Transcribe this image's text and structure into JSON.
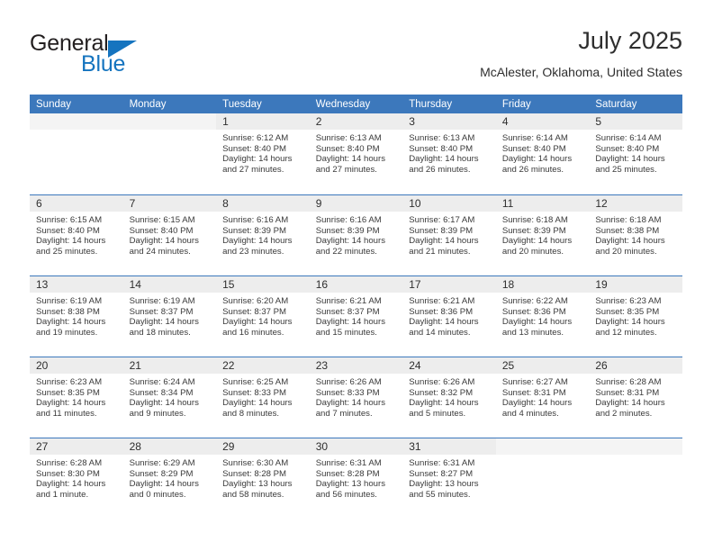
{
  "brand": {
    "name_top": "General",
    "name_bottom": "Blue",
    "color_dark": "#231f20",
    "color_blue": "#1574bf"
  },
  "header": {
    "title": "July 2025",
    "subtitle": "McAlester, Oklahoma, United States"
  },
  "theme": {
    "header_bg": "#3c78bc",
    "daynum_bg": "#ededed",
    "separator": "#3c78bc"
  },
  "weekdays": [
    "Sunday",
    "Monday",
    "Tuesday",
    "Wednesday",
    "Thursday",
    "Friday",
    "Saturday"
  ],
  "labels": {
    "sunrise": "Sunrise:",
    "sunset": "Sunset:",
    "daylight": "Daylight:"
  },
  "weeks": [
    [
      {
        "day": "",
        "sunrise": "",
        "sunset": "",
        "daylight_1": "",
        "daylight_2": ""
      },
      {
        "day": "",
        "sunrise": "",
        "sunset": "",
        "daylight_1": "",
        "daylight_2": ""
      },
      {
        "day": "1",
        "sunrise": "Sunrise: 6:12 AM",
        "sunset": "Sunset: 8:40 PM",
        "daylight_1": "Daylight: 14 hours",
        "daylight_2": "and 27 minutes."
      },
      {
        "day": "2",
        "sunrise": "Sunrise: 6:13 AM",
        "sunset": "Sunset: 8:40 PM",
        "daylight_1": "Daylight: 14 hours",
        "daylight_2": "and 27 minutes."
      },
      {
        "day": "3",
        "sunrise": "Sunrise: 6:13 AM",
        "sunset": "Sunset: 8:40 PM",
        "daylight_1": "Daylight: 14 hours",
        "daylight_2": "and 26 minutes."
      },
      {
        "day": "4",
        "sunrise": "Sunrise: 6:14 AM",
        "sunset": "Sunset: 8:40 PM",
        "daylight_1": "Daylight: 14 hours",
        "daylight_2": "and 26 minutes."
      },
      {
        "day": "5",
        "sunrise": "Sunrise: 6:14 AM",
        "sunset": "Sunset: 8:40 PM",
        "daylight_1": "Daylight: 14 hours",
        "daylight_2": "and 25 minutes."
      }
    ],
    [
      {
        "day": "6",
        "sunrise": "Sunrise: 6:15 AM",
        "sunset": "Sunset: 8:40 PM",
        "daylight_1": "Daylight: 14 hours",
        "daylight_2": "and 25 minutes."
      },
      {
        "day": "7",
        "sunrise": "Sunrise: 6:15 AM",
        "sunset": "Sunset: 8:40 PM",
        "daylight_1": "Daylight: 14 hours",
        "daylight_2": "and 24 minutes."
      },
      {
        "day": "8",
        "sunrise": "Sunrise: 6:16 AM",
        "sunset": "Sunset: 8:39 PM",
        "daylight_1": "Daylight: 14 hours",
        "daylight_2": "and 23 minutes."
      },
      {
        "day": "9",
        "sunrise": "Sunrise: 6:16 AM",
        "sunset": "Sunset: 8:39 PM",
        "daylight_1": "Daylight: 14 hours",
        "daylight_2": "and 22 minutes."
      },
      {
        "day": "10",
        "sunrise": "Sunrise: 6:17 AM",
        "sunset": "Sunset: 8:39 PM",
        "daylight_1": "Daylight: 14 hours",
        "daylight_2": "and 21 minutes."
      },
      {
        "day": "11",
        "sunrise": "Sunrise: 6:18 AM",
        "sunset": "Sunset: 8:39 PM",
        "daylight_1": "Daylight: 14 hours",
        "daylight_2": "and 20 minutes."
      },
      {
        "day": "12",
        "sunrise": "Sunrise: 6:18 AM",
        "sunset": "Sunset: 8:38 PM",
        "daylight_1": "Daylight: 14 hours",
        "daylight_2": "and 20 minutes."
      }
    ],
    [
      {
        "day": "13",
        "sunrise": "Sunrise: 6:19 AM",
        "sunset": "Sunset: 8:38 PM",
        "daylight_1": "Daylight: 14 hours",
        "daylight_2": "and 19 minutes."
      },
      {
        "day": "14",
        "sunrise": "Sunrise: 6:19 AM",
        "sunset": "Sunset: 8:37 PM",
        "daylight_1": "Daylight: 14 hours",
        "daylight_2": "and 18 minutes."
      },
      {
        "day": "15",
        "sunrise": "Sunrise: 6:20 AM",
        "sunset": "Sunset: 8:37 PM",
        "daylight_1": "Daylight: 14 hours",
        "daylight_2": "and 16 minutes."
      },
      {
        "day": "16",
        "sunrise": "Sunrise: 6:21 AM",
        "sunset": "Sunset: 8:37 PM",
        "daylight_1": "Daylight: 14 hours",
        "daylight_2": "and 15 minutes."
      },
      {
        "day": "17",
        "sunrise": "Sunrise: 6:21 AM",
        "sunset": "Sunset: 8:36 PM",
        "daylight_1": "Daylight: 14 hours",
        "daylight_2": "and 14 minutes."
      },
      {
        "day": "18",
        "sunrise": "Sunrise: 6:22 AM",
        "sunset": "Sunset: 8:36 PM",
        "daylight_1": "Daylight: 14 hours",
        "daylight_2": "and 13 minutes."
      },
      {
        "day": "19",
        "sunrise": "Sunrise: 6:23 AM",
        "sunset": "Sunset: 8:35 PM",
        "daylight_1": "Daylight: 14 hours",
        "daylight_2": "and 12 minutes."
      }
    ],
    [
      {
        "day": "20",
        "sunrise": "Sunrise: 6:23 AM",
        "sunset": "Sunset: 8:35 PM",
        "daylight_1": "Daylight: 14 hours",
        "daylight_2": "and 11 minutes."
      },
      {
        "day": "21",
        "sunrise": "Sunrise: 6:24 AM",
        "sunset": "Sunset: 8:34 PM",
        "daylight_1": "Daylight: 14 hours",
        "daylight_2": "and 9 minutes."
      },
      {
        "day": "22",
        "sunrise": "Sunrise: 6:25 AM",
        "sunset": "Sunset: 8:33 PM",
        "daylight_1": "Daylight: 14 hours",
        "daylight_2": "and 8 minutes."
      },
      {
        "day": "23",
        "sunrise": "Sunrise: 6:26 AM",
        "sunset": "Sunset: 8:33 PM",
        "daylight_1": "Daylight: 14 hours",
        "daylight_2": "and 7 minutes."
      },
      {
        "day": "24",
        "sunrise": "Sunrise: 6:26 AM",
        "sunset": "Sunset: 8:32 PM",
        "daylight_1": "Daylight: 14 hours",
        "daylight_2": "and 5 minutes."
      },
      {
        "day": "25",
        "sunrise": "Sunrise: 6:27 AM",
        "sunset": "Sunset: 8:31 PM",
        "daylight_1": "Daylight: 14 hours",
        "daylight_2": "and 4 minutes."
      },
      {
        "day": "26",
        "sunrise": "Sunrise: 6:28 AM",
        "sunset": "Sunset: 8:31 PM",
        "daylight_1": "Daylight: 14 hours",
        "daylight_2": "and 2 minutes."
      }
    ],
    [
      {
        "day": "27",
        "sunrise": "Sunrise: 6:28 AM",
        "sunset": "Sunset: 8:30 PM",
        "daylight_1": "Daylight: 14 hours",
        "daylight_2": "and 1 minute."
      },
      {
        "day": "28",
        "sunrise": "Sunrise: 6:29 AM",
        "sunset": "Sunset: 8:29 PM",
        "daylight_1": "Daylight: 14 hours",
        "daylight_2": "and 0 minutes."
      },
      {
        "day": "29",
        "sunrise": "Sunrise: 6:30 AM",
        "sunset": "Sunset: 8:28 PM",
        "daylight_1": "Daylight: 13 hours",
        "daylight_2": "and 58 minutes."
      },
      {
        "day": "30",
        "sunrise": "Sunrise: 6:31 AM",
        "sunset": "Sunset: 8:28 PM",
        "daylight_1": "Daylight: 13 hours",
        "daylight_2": "and 56 minutes."
      },
      {
        "day": "31",
        "sunrise": "Sunrise: 6:31 AM",
        "sunset": "Sunset: 8:27 PM",
        "daylight_1": "Daylight: 13 hours",
        "daylight_2": "and 55 minutes."
      },
      {
        "day": "",
        "sunrise": "",
        "sunset": "",
        "daylight_1": "",
        "daylight_2": ""
      },
      {
        "day": "",
        "sunrise": "",
        "sunset": "",
        "daylight_1": "",
        "daylight_2": ""
      }
    ]
  ]
}
